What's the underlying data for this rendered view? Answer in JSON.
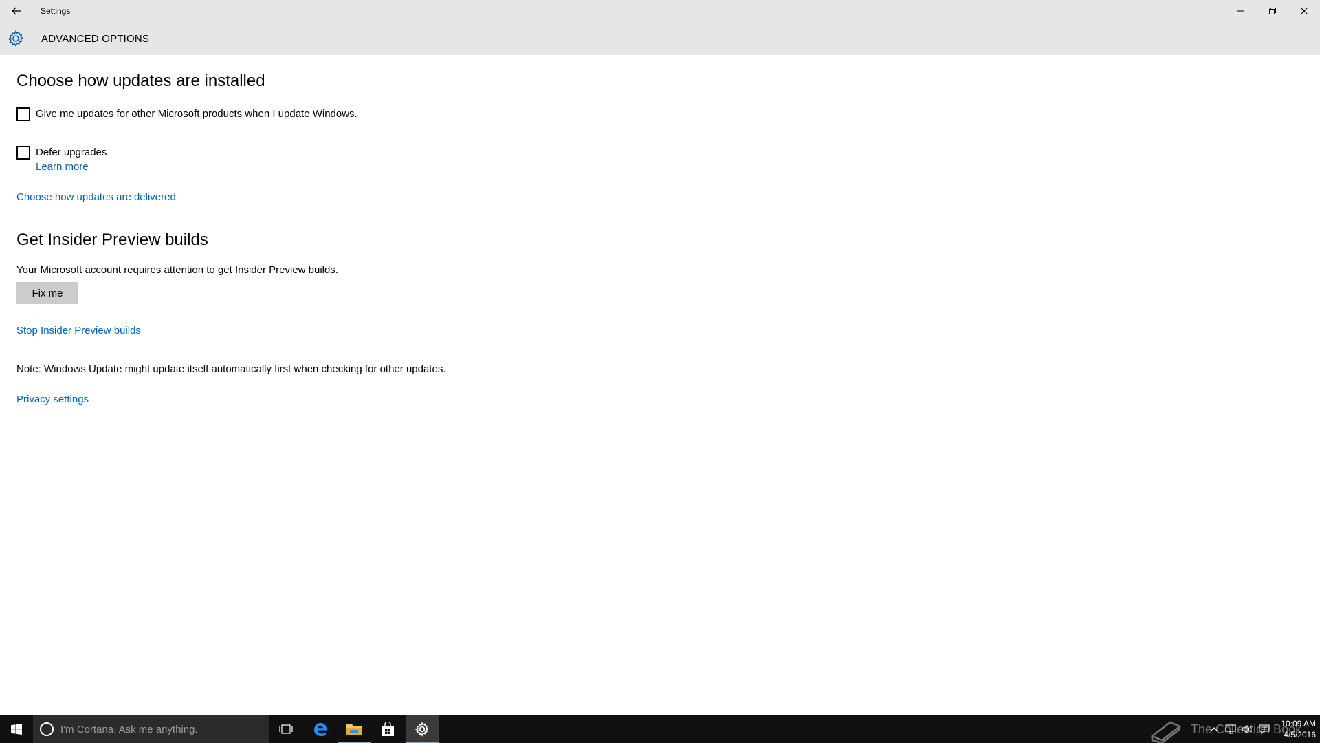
{
  "window": {
    "title": "Settings"
  },
  "header": {
    "title": "ADVANCED OPTIONS"
  },
  "install_section": {
    "heading": "Choose how updates are installed",
    "other_products_checkbox": {
      "label": "Give me updates for other Microsoft products when I update Windows.",
      "checked": false
    },
    "defer_checkbox": {
      "label": "Defer upgrades",
      "checked": false
    },
    "learn_more": "Learn more",
    "delivered_link": "Choose how updates are delivered"
  },
  "insider_section": {
    "heading": "Get Insider Preview builds",
    "message": "Your Microsoft account requires attention to get Insider Preview builds.",
    "fix_button": "Fix me",
    "stop_link": "Stop Insider Preview builds"
  },
  "note": "Note: Windows Update might update itself automatically first when checking for other updates.",
  "privacy_link": "Privacy settings",
  "taskbar": {
    "search_placeholder": "I'm Cortana. Ask me anything.",
    "pinned": [
      "task-view-icon",
      "edge-icon",
      "file-explorer-icon",
      "store-icon",
      "settings-icon"
    ],
    "clock_time": "10:09 AM",
    "clock_date": "4/5/2016",
    "watermark": "The Collection Book"
  },
  "colors": {
    "accent": "#0063b1",
    "chrome": "#e6e6e6",
    "taskbar": "#101010"
  }
}
